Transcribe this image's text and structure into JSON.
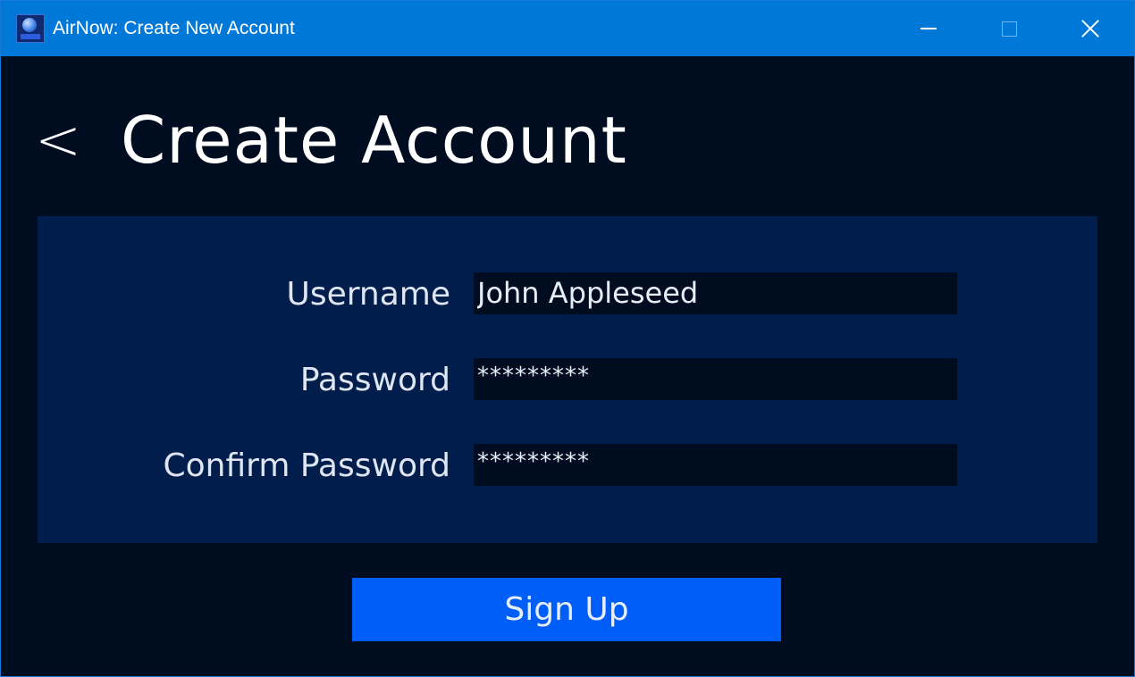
{
  "window": {
    "title": "AirNow: Create New Account",
    "accent_color": "#0078d7",
    "controls": {
      "minimize_icon": "minimize-icon",
      "maximize_icon": "maximize-icon",
      "close_icon": "close-icon"
    }
  },
  "header": {
    "back_label": "<",
    "title": "Create Account"
  },
  "form": {
    "panel_color": "#001d4c",
    "fields": [
      {
        "label": "Username",
        "value": "John Appleseed"
      },
      {
        "label": "Password",
        "value": "*********"
      },
      {
        "label": "Confirm Password",
        "value": "*********"
      }
    ]
  },
  "actions": {
    "signup_label": "Sign Up",
    "signup_color": "#005ef8"
  }
}
